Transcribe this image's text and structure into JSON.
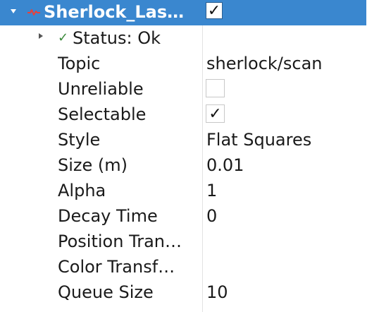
{
  "display": {
    "title": "Sherlock_Las…",
    "enabled_mark": "✓",
    "icon": "laser-scan-icon",
    "accent_color": "#3a87cf"
  },
  "status": {
    "icon": "checkmark-icon",
    "icon_glyph": "✓",
    "label": "Status: Ok"
  },
  "properties": [
    {
      "name": "Topic",
      "value": "sherlock/scan"
    },
    {
      "name": "Unreliable",
      "checked": false,
      "mark": ""
    },
    {
      "name": "Selectable",
      "checked": true,
      "mark": "✓"
    },
    {
      "name": "Style",
      "value": "Flat Squares"
    },
    {
      "name": "Size (m)",
      "value": "0.01"
    },
    {
      "name": "Alpha",
      "value": "1"
    },
    {
      "name": "Decay Time",
      "value": "0"
    },
    {
      "name": "Position Tran…",
      "value": ""
    },
    {
      "name": "Color Transf…",
      "value": ""
    },
    {
      "name": "Queue Size",
      "value": "10"
    }
  ]
}
